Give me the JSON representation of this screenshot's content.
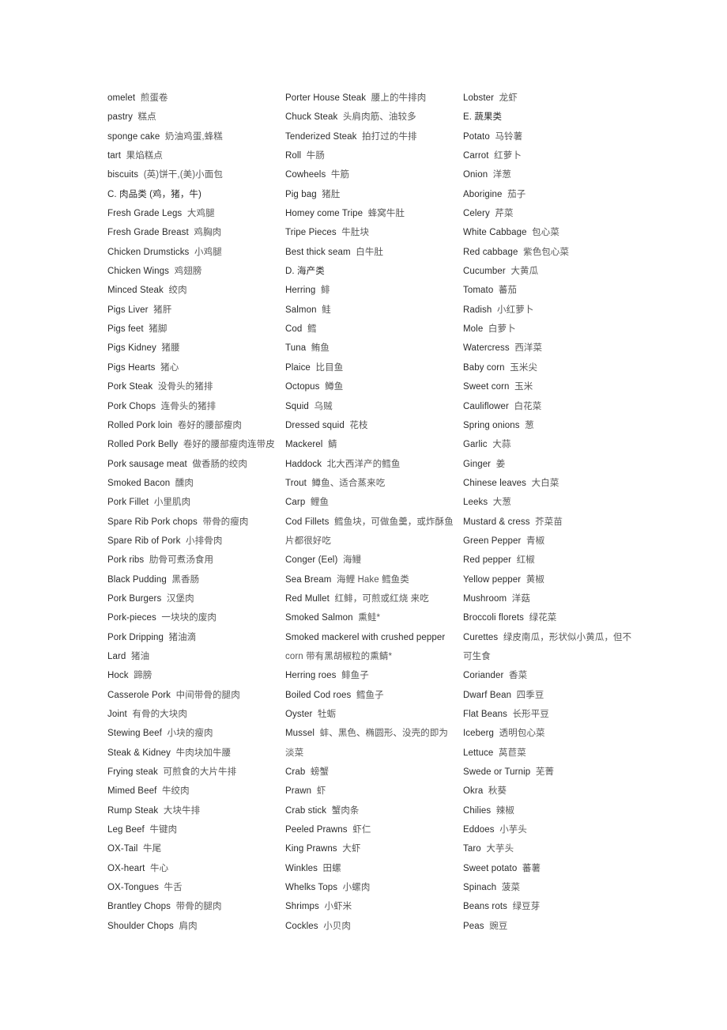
{
  "document": {
    "title": "English-Chinese Food Vocabulary List",
    "layout": "three-column glossary"
  },
  "columns": [
    {
      "name": "column-1",
      "entries": [
        {
          "en": "omelet",
          "zh": "煎蛋卷"
        },
        {
          "en": "pastry",
          "zh": "糕点"
        },
        {
          "en": "sponge cake",
          "zh": "奶油鸡蛋,蜂糕"
        },
        {
          "en": "tart",
          "zh": "果焰糕点"
        },
        {
          "en": "biscuits",
          "zh": "(英)饼干,(美)小面包"
        },
        {
          "en": "C. 肉品类 (鸡，猪，牛)",
          "zh": ""
        },
        {
          "en": "Fresh Grade Legs",
          "zh": "大鸡腿"
        },
        {
          "en": "Fresh Grade Breast",
          "zh": "鸡胸肉"
        },
        {
          "en": "Chicken Drumsticks",
          "zh": "小鸡腿"
        },
        {
          "en": "Chicken Wings",
          "zh": "鸡翅膀"
        },
        {
          "en": "Minced Steak",
          "zh": "绞肉"
        },
        {
          "en": "Pigs Liver",
          "zh": "猪肝"
        },
        {
          "en": "Pigs feet",
          "zh": "猪脚"
        },
        {
          "en": "Pigs Kidney",
          "zh": "猪腰"
        },
        {
          "en": "Pigs Hearts",
          "zh": "猪心"
        },
        {
          "en": "Pork Steak",
          "zh": "没骨头的猪排"
        },
        {
          "en": "Pork Chops",
          "zh": "连骨头的猪排"
        },
        {
          "en": "Rolled Pork loin",
          "zh": "卷好的腰部瘦肉"
        },
        {
          "en": "Rolled Pork Belly",
          "zh": "卷好的腰部瘦肉连带皮"
        },
        {
          "en": "Pork sausage meat",
          "zh": "做香肠的绞肉"
        },
        {
          "en": "Smoked Bacon",
          "zh": "醺肉"
        },
        {
          "en": "Pork Fillet",
          "zh": "小里肌肉"
        },
        {
          "en": "Spare Rib Pork chops",
          "zh": "带骨的瘦肉"
        },
        {
          "en": "Spare Rib of Pork",
          "zh": "小排骨肉"
        },
        {
          "en": "Pork ribs",
          "zh": "肋骨可煮汤食用"
        },
        {
          "en": "Black Pudding",
          "zh": "黑香肠"
        },
        {
          "en": "Pork Burgers",
          "zh": "汉堡肉"
        },
        {
          "en": "Pork-pieces",
          "zh": "一块块的废肉"
        },
        {
          "en": "Pork Dripping",
          "zh": "猪油滴"
        },
        {
          "en": "Lard",
          "zh": "猪油"
        },
        {
          "en": "Hock",
          "zh": "蹄膀"
        },
        {
          "en": "Casserole Pork",
          "zh": "中间带骨的腿肉"
        },
        {
          "en": "Joint",
          "zh": "有骨的大块肉"
        },
        {
          "en": "Stewing Beef",
          "zh": "小块的瘦肉"
        },
        {
          "en": "Steak & Kidney",
          "zh": "牛肉块加牛腰"
        },
        {
          "en": "Frying steak",
          "zh": "可煎食的大片牛排"
        },
        {
          "en": "Mimed Beef",
          "zh": "牛绞肉"
        },
        {
          "en": "Rump Steak",
          "zh": "大块牛排"
        },
        {
          "en": "Leg Beef",
          "zh": "牛键肉"
        },
        {
          "en": "OX-Tail",
          "zh": "牛尾"
        },
        {
          "en": "OX-heart",
          "zh": "牛心"
        },
        {
          "en": "OX-Tongues",
          "zh": "牛舌"
        },
        {
          "en": "Brantley Chops",
          "zh": "带骨的腿肉"
        },
        {
          "en": "Shoulder Chops",
          "zh": "肩肉"
        }
      ]
    },
    {
      "name": "column-2",
      "entries": [
        {
          "en": "Porter House Steak",
          "zh": "腰上的牛排肉"
        },
        {
          "en": "Chuck Steak",
          "zh": "头肩肉筋、油较多"
        },
        {
          "en": "Tenderized Steak",
          "zh": "拍打过的牛排"
        },
        {
          "en": "Roll",
          "zh": "牛肠"
        },
        {
          "en": "Cowheels",
          "zh": "牛筋"
        },
        {
          "en": "Pig bag",
          "zh": "猪肚"
        },
        {
          "en": "Homey come Tripe",
          "zh": "蜂窝牛肚"
        },
        {
          "en": "Tripe Pieces",
          "zh": "牛肚块"
        },
        {
          "en": "Best thick seam",
          "zh": "白牛肚"
        },
        {
          "en": "D. 海产类",
          "zh": ""
        },
        {
          "en": "Herring",
          "zh": "鲱"
        },
        {
          "en": "Salmon",
          "zh": "鲑"
        },
        {
          "en": "Cod",
          "zh": "鳕"
        },
        {
          "en": "Tuna",
          "zh": "鲔鱼"
        },
        {
          "en": "Plaice",
          "zh": "比目鱼"
        },
        {
          "en": "Octopus",
          "zh": "鳟鱼"
        },
        {
          "en": "Squid",
          "zh": "乌贼"
        },
        {
          "en": "Dressed squid",
          "zh": "花枝"
        },
        {
          "en": "Mackerel",
          "zh": "鲭"
        },
        {
          "en": "Haddock",
          "zh": "北大西洋产的鳕鱼"
        },
        {
          "en": "Trout",
          "zh": "鳟鱼、适合蒸来吃"
        },
        {
          "en": "Carp",
          "zh": "鲤鱼"
        },
        {
          "en": "Cod Fillets",
          "zh": "鳕鱼块，可做鱼羹，或炸酥鱼",
          "cont": "片都很好吃"
        },
        {
          "en": "Conger (Eel)",
          "zh": "海鳗"
        },
        {
          "en": "Sea Bream",
          "zh": "海鲤  Hake  鳕鱼类"
        },
        {
          "en": "Red Mullet",
          "zh": "红鲱，可煎或红烧 来吃"
        },
        {
          "en": "Smoked Salmon",
          "zh": "熏鲑*"
        },
        {
          "en": "Smoked mackerel with crushed pepper",
          "zh": "",
          "cont": "corn 带有黑胡椒粒的熏鲭*"
        },
        {
          "en": "Herring roes",
          "zh": "鲱鱼子"
        },
        {
          "en": "Boiled Cod roes",
          "zh": "鳕鱼子"
        },
        {
          "en": "Oyster",
          "zh": "牡蛎"
        },
        {
          "en": "Mussel",
          "zh": "蚌、黑色、椭圆形、没壳的即为",
          "cont": "淡菜"
        },
        {
          "en": "Crab",
          "zh": "螃蟹"
        },
        {
          "en": "Prawn",
          "zh": "虾"
        },
        {
          "en": "Crab stick",
          "zh": "蟹肉条"
        },
        {
          "en": "Peeled Prawns",
          "zh": "虾仁"
        },
        {
          "en": "King Prawns",
          "zh": "大虾"
        },
        {
          "en": "Winkles",
          "zh": "田螺"
        },
        {
          "en": "Whelks Tops",
          "zh": "小螺肉"
        },
        {
          "en": "Shrimps",
          "zh": "小虾米"
        },
        {
          "en": "Cockles",
          "zh": "小贝肉"
        }
      ]
    },
    {
      "name": "column-3",
      "entries": [
        {
          "en": "Lobster",
          "zh": "龙虾"
        },
        {
          "en": "E. 蔬果类",
          "zh": ""
        },
        {
          "en": "Potato",
          "zh": "马铃薯"
        },
        {
          "en": "Carrot",
          "zh": "红萝卜"
        },
        {
          "en": "Onion",
          "zh": "洋葱"
        },
        {
          "en": "Aborigine",
          "zh": "茄子"
        },
        {
          "en": "Celery",
          "zh": "芹菜"
        },
        {
          "en": "White Cabbage",
          "zh": "包心菜"
        },
        {
          "en": "Red cabbage",
          "zh": "紫色包心菜"
        },
        {
          "en": "Cucumber",
          "zh": "大黄瓜"
        },
        {
          "en": "Tomato",
          "zh": "蕃茄"
        },
        {
          "en": "Radish",
          "zh": "小红萝卜"
        },
        {
          "en": "Mole",
          "zh": "白萝卜"
        },
        {
          "en": "Watercress",
          "zh": "西洋菜"
        },
        {
          "en": "Baby corn",
          "zh": "玉米尖"
        },
        {
          "en": "Sweet corn",
          "zh": "玉米"
        },
        {
          "en": "Cauliflower",
          "zh": "白花菜"
        },
        {
          "en": "Spring onions",
          "zh": "葱"
        },
        {
          "en": "Garlic",
          "zh": "大蒜"
        },
        {
          "en": "Ginger",
          "zh": "姜"
        },
        {
          "en": "Chinese leaves",
          "zh": "大白菜"
        },
        {
          "en": "Leeks",
          "zh": "大葱"
        },
        {
          "en": "Mustard & cress",
          "zh": "芥菜苗"
        },
        {
          "en": "Green Pepper",
          "zh": "青椒"
        },
        {
          "en": "Red pepper",
          "zh": "红椒"
        },
        {
          "en": "Yellow pepper",
          "zh": "黄椒"
        },
        {
          "en": "Mushroom",
          "zh": "洋菇"
        },
        {
          "en": "Broccoli florets",
          "zh": "绿花菜"
        },
        {
          "en": "Curettes",
          "zh": "绿皮南瓜，形状似小黄瓜，但不",
          "cont": "可生食"
        },
        {
          "en": "Coriander",
          "zh": "香菜"
        },
        {
          "en": "Dwarf Bean",
          "zh": "四季豆"
        },
        {
          "en": "Flat Beans",
          "zh": "长形平豆"
        },
        {
          "en": "Iceberg",
          "zh": "透明包心菜"
        },
        {
          "en": "Lettuce",
          "zh": "莴苣菜"
        },
        {
          "en": "Swede or Turnip",
          "zh": "芜菁"
        },
        {
          "en": "Okra",
          "zh": "秋葵"
        },
        {
          "en": "Chilies",
          "zh": "辣椒"
        },
        {
          "en": "Eddoes",
          "zh": "小芋头"
        },
        {
          "en": "Taro",
          "zh": "大芋头"
        },
        {
          "en": "Sweet potato",
          "zh": "蕃薯"
        },
        {
          "en": "Spinach",
          "zh": "菠菜"
        },
        {
          "en": "Beans rots",
          "zh": "绿豆芽"
        },
        {
          "en": "Peas",
          "zh": "豌豆"
        }
      ]
    }
  ]
}
